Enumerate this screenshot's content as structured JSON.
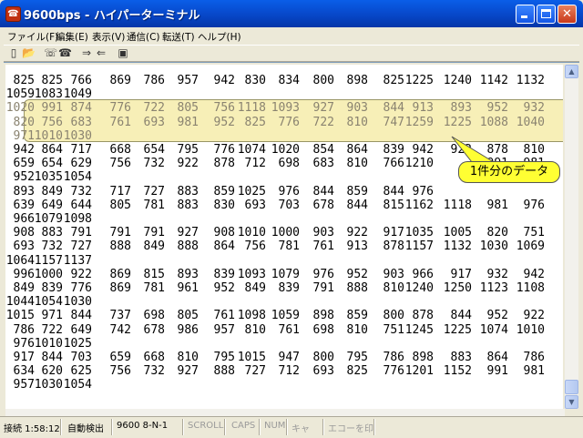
{
  "window": {
    "title": "9600bps - ハイパーターミナル",
    "icon": "phone-terminal-icon"
  },
  "menu": [
    "ファイル(F)",
    "編集(E)",
    "表示(V)",
    "通信(C)",
    "転送(T)",
    "ヘルプ(H)"
  ],
  "toolbar": [
    "new-icon",
    "open-icon",
    "connect-icon",
    "disconnect-icon",
    "send-icon",
    "receive-icon",
    "properties-icon"
  ],
  "terminal": {
    "rows": [
      [
        "825",
        "825",
        "766",
        "869",
        "786",
        "957",
        "942",
        "830",
        "834",
        "800",
        "898",
        "825",
        "1225",
        "1240",
        "1142",
        "1132"
      ],
      [
        "1059",
        "1083",
        "1049"
      ],
      [
        "1020",
        "991",
        "874",
        "776",
        "722",
        "805",
        "756",
        "1118",
        "1093",
        "927",
        "903",
        "844",
        "913",
        "893",
        "952",
        "932"
      ],
      [
        "820",
        "756",
        "683",
        "761",
        "693",
        "981",
        "952",
        "825",
        "776",
        "722",
        "810",
        "747",
        "1259",
        "1225",
        "1088",
        "1040"
      ],
      [
        "971",
        "1010",
        "1030"
      ],
      [
        "942",
        "864",
        "717",
        "668",
        "654",
        "795",
        "776",
        "1074",
        "1020",
        "854",
        "864",
        "839",
        "942",
        "922",
        "878",
        "810"
      ],
      [
        "659",
        "654",
        "629",
        "756",
        "732",
        "922",
        "878",
        "712",
        "698",
        "683",
        "810",
        "766",
        "1210",
        "",
        "991",
        "981"
      ],
      [
        "952",
        "1035",
        "1054"
      ],
      [
        "893",
        "849",
        "732",
        "717",
        "727",
        "883",
        "859",
        "1025",
        "976",
        "844",
        "859",
        "844",
        "976",
        "",
        "",
        ""
      ],
      [
        "639",
        "649",
        "644",
        "805",
        "781",
        "883",
        "830",
        "693",
        "703",
        "678",
        "844",
        "815",
        "1162",
        "1118",
        "981",
        "976"
      ],
      [
        "966",
        "1079",
        "1098"
      ],
      [
        "908",
        "883",
        "791",
        "791",
        "791",
        "927",
        "908",
        "1010",
        "1000",
        "903",
        "922",
        "917",
        "1035",
        "1005",
        "820",
        "751"
      ],
      [
        "693",
        "732",
        "727",
        "888",
        "849",
        "888",
        "864",
        "756",
        "781",
        "761",
        "913",
        "878",
        "1157",
        "1132",
        "1030",
        "1069"
      ],
      [
        "1064",
        "1157",
        "1137"
      ],
      [
        "996",
        "1000",
        "922",
        "869",
        "815",
        "893",
        "839",
        "1093",
        "1079",
        "976",
        "952",
        "903",
        "966",
        "917",
        "932",
        "942"
      ],
      [
        "849",
        "839",
        "776",
        "869",
        "781",
        "961",
        "952",
        "849",
        "839",
        "791",
        "888",
        "810",
        "1240",
        "1250",
        "1123",
        "1108"
      ],
      [
        "1044",
        "1054",
        "1030"
      ],
      [
        "1015",
        "971",
        "844",
        "737",
        "698",
        "805",
        "761",
        "1098",
        "1059",
        "898",
        "859",
        "800",
        "878",
        "844",
        "952",
        "922"
      ],
      [
        "786",
        "722",
        "649",
        "742",
        "678",
        "986",
        "957",
        "810",
        "761",
        "698",
        "810",
        "751",
        "1245",
        "1225",
        "1074",
        "1010"
      ],
      [
        "976",
        "1010",
        "1025"
      ],
      [
        "917",
        "844",
        "703",
        "659",
        "668",
        "810",
        "795",
        "1015",
        "947",
        "800",
        "795",
        "786",
        "898",
        "883",
        "864",
        "786"
      ],
      [
        "634",
        "620",
        "625",
        "756",
        "732",
        "927",
        "888",
        "727",
        "712",
        "693",
        "825",
        "776",
        "1201",
        "1152",
        "991",
        "981"
      ],
      [
        "957",
        "1030",
        "1054"
      ]
    ],
    "highlight_rows": [
      2,
      3,
      4
    ]
  },
  "callout": {
    "text": "1件分のデータ",
    "color": "#ffff33"
  },
  "status": {
    "connected": "接続 1:58:12",
    "detect": "自動検出",
    "settings": "9600 8-N-1",
    "scroll": "SCROLL",
    "caps": "CAPS",
    "num": "NUM",
    "capture": "キャ",
    "echo": "エコーを印"
  }
}
